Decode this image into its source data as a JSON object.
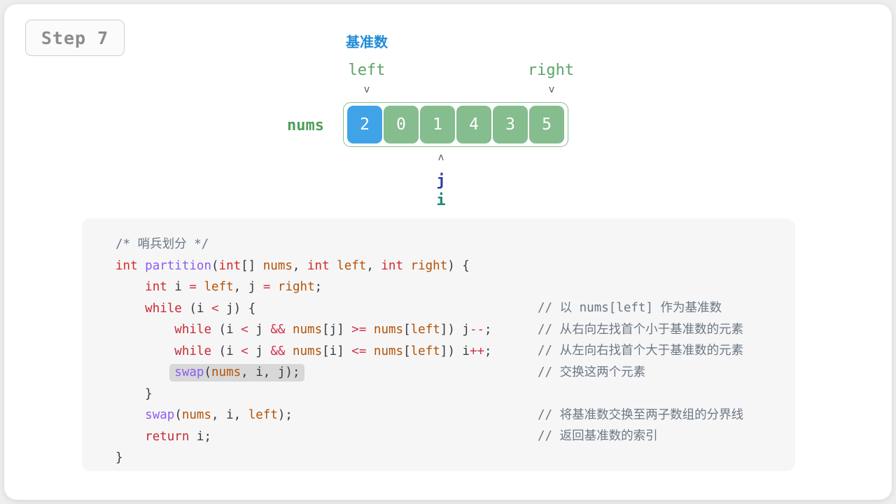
{
  "badge": {
    "label": "Step 7"
  },
  "diagram": {
    "pivot_label": "基准数",
    "pivot_label_color": "#1f8bd6",
    "array_name": "nums",
    "array_name_color": "#4e9f5a",
    "left_pointer": {
      "name": "left",
      "marker": "ᴠ",
      "index": 0
    },
    "right_pointer": {
      "name": "right",
      "marker": "ᴠ",
      "index": 5
    },
    "cells": [
      {
        "value": "2",
        "highlight": "pivot",
        "color": "#40a3e8"
      },
      {
        "value": "0",
        "highlight": "normal",
        "color": "#85bd8e"
      },
      {
        "value": "1",
        "highlight": "normal",
        "color": "#85bd8e"
      },
      {
        "value": "4",
        "highlight": "normal",
        "color": "#85bd8e"
      },
      {
        "value": "3",
        "highlight": "normal",
        "color": "#85bd8e"
      },
      {
        "value": "5",
        "highlight": "normal",
        "color": "#85bd8e"
      }
    ],
    "below_marker": "ᴧ",
    "j_pointer": {
      "name": "j",
      "index": 2,
      "color": "#2b3fae"
    },
    "i_pointer": {
      "name": "i",
      "index": 2,
      "color": "#1f8a78"
    }
  },
  "code": {
    "language": "java",
    "highlighted_line": "swap(nums, i, j);",
    "lines": [
      {
        "text": "/* 哨兵划分 */",
        "comment": ""
      },
      {
        "text": "int partition(int[] nums, int left, int right) {",
        "comment": ""
      },
      {
        "text": "    int i = left, j = right;",
        "comment": ""
      },
      {
        "text": "    while (i < j) {",
        "comment": "// 以 nums[left] 作为基准数"
      },
      {
        "text": "        while (i < j && nums[j] >= nums[left]) j--;",
        "comment": "// 从右向左找首个小于基准数的元素"
      },
      {
        "text": "        while (i < j && nums[i] <= nums[left]) i++;",
        "comment": "// 从左向右找首个大于基准数的元素"
      },
      {
        "text": "        swap(nums, i, j);",
        "comment": "// 交换这两个元素"
      },
      {
        "text": "    }",
        "comment": ""
      },
      {
        "text": "    swap(nums, i, left);",
        "comment": "// 将基准数交换至两子数组的分界线"
      },
      {
        "text": "    return i;",
        "comment": "// 返回基准数的索引"
      },
      {
        "text": "}",
        "comment": ""
      }
    ],
    "comments": {
      "c1": "// 以 nums[left] 作为基准数",
      "c2": "// 从右向左找首个小于基准数的元素",
      "c3": "// 从左向右找首个大于基准数的元素",
      "c4": "// 交换这两个元素",
      "c5": "// 将基准数交换至两子数组的分界线",
      "c6": "// 返回基准数的索引"
    },
    "tokens": {
      "cmt_header": "/* 哨兵划分 */",
      "int": "int",
      "partition": "partition",
      "brackets": "[]",
      "nums": "nums",
      "left": "left",
      "right": "right",
      "i": "i",
      "j": "j",
      "while": "while",
      "swap": "swap",
      "return": "return"
    }
  }
}
